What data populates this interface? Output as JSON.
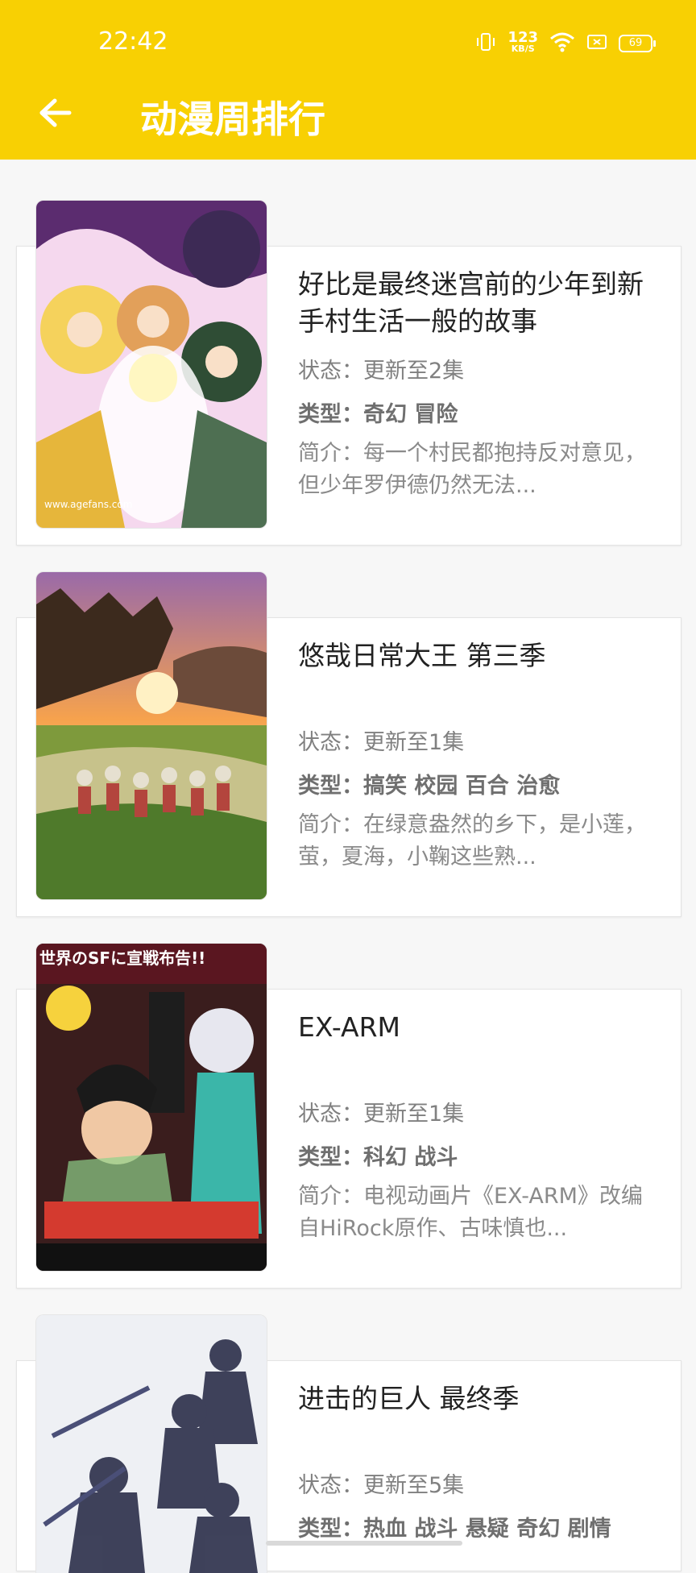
{
  "status": {
    "time": "22:42",
    "kbps_value": "123",
    "kbps_unit": "KB/S",
    "battery": "69"
  },
  "header": {
    "title": "动漫周排行"
  },
  "items": [
    {
      "title": "好比是最终迷宫前的少年到新手村生活一般的故事",
      "status": "状态：更新至2集",
      "type": "类型：奇幻 冒险",
      "desc": "简介：每一个村民都抱持反对意见，但少年罗伊德仍然无法...",
      "cover_text": "www.agefans.com"
    },
    {
      "title": "悠哉日常大王 第三季",
      "status": "状态：更新至1集",
      "type": "类型：搞笑 校园 百合 治愈",
      "desc": "简介：在绿意盎然的乡下，是小莲，萤，夏海，小鞠这些熟..."
    },
    {
      "title": "EX-ARM",
      "status": "状态：更新至1集",
      "type": "类型：科幻 战斗",
      "desc": "简介：电视动画片《EX-ARM》改编自HiRock原作、古味慎也...",
      "cover_text": "世界のSFに宣戦布告!!"
    },
    {
      "title": "进击的巨人 最终季",
      "status": "状态：更新至5集",
      "type": "类型：热血 战斗 悬疑 奇幻 剧情",
      "desc": ""
    }
  ]
}
